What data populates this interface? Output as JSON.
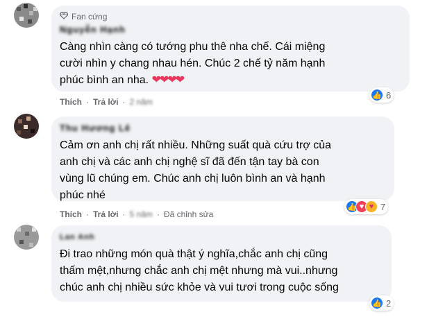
{
  "comments": [
    {
      "badge": "Fan cứng",
      "author": "Nguyễn Hạnh",
      "text_lines": [
        "Càng nhìn càng có tướng phu thê nha chế. Cái miệng",
        "cười nhìn y chang nhau hén. Chúc 2 chế tỷ năm hạnh",
        "phúc bình an nha."
      ],
      "hearts": "❤❤❤❤",
      "actions": {
        "like": "Thích",
        "reply": "Trả lời",
        "time": "2 năm",
        "edited": ""
      },
      "reactions": {
        "icons": [
          "like-icon"
        ],
        "count": "6"
      }
    },
    {
      "badge": "",
      "author": "Thu Hương Lê",
      "text_lines": [
        "Cảm ơn anh chị rất nhiều. Những suất quà cứu trợ của",
        "anh chị và các anh chị nghệ sĩ đã đến tận tay bà con",
        "vùng lũ chúng em. Chúc anh chị luôn bình an và hạnh",
        "phúc nhé"
      ],
      "actions": {
        "like": "Thích",
        "reply": "Trả lời",
        "time": "5 năm",
        "edited": "Đã chỉnh sửa"
      },
      "reactions": {
        "icons": [
          "like-icon",
          "love-icon",
          "care-icon"
        ],
        "count": "7"
      }
    },
    {
      "badge": "",
      "author": "Lan Anh",
      "text_lines": [
        "Đi trao những món quà thật ý nghĩa,chắc anh chị cũng",
        "thấm mệt,nhưng chắc anh chị mệt nhưng mà vui..nhưng",
        "chúc anh chị nhiều sức khỏe và vui tươi trong cuộc sống"
      ],
      "actions": {
        "like": "Thích",
        "reply": "Trả lời",
        "time": "",
        "edited": ""
      },
      "reactions": {
        "icons": [
          "like-icon"
        ],
        "count": "2"
      }
    }
  ],
  "colors": {
    "bubble": "#f0f2f5",
    "like_blue": "#1877f2",
    "love_red": "#f33e58",
    "care_yellow": "#f7b125",
    "meta_gray": "#65676b"
  }
}
